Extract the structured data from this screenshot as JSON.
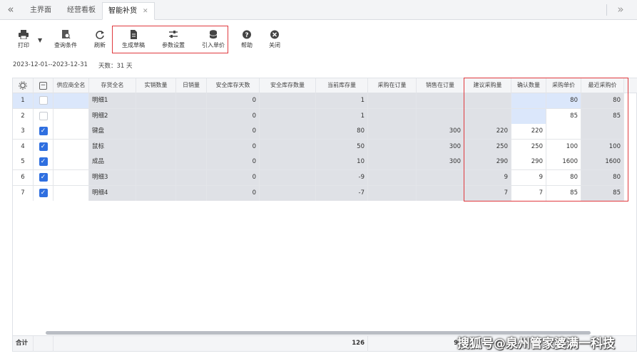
{
  "tabs": [
    {
      "label": "主界面"
    },
    {
      "label": "经营看板"
    },
    {
      "label": "智能补货",
      "closable": true
    }
  ],
  "tab_nav": {
    "left": "«",
    "right": "»"
  },
  "toolbar": {
    "print": "打印",
    "query": "查询条件",
    "refresh": "刷新",
    "generate_draft": "生成草稿",
    "params": "参数设置",
    "import_price": "引入单价",
    "help": "帮助",
    "close": "关闭"
  },
  "info": {
    "date_range": "2023-12-01--2023-12-31",
    "days": "天数：31 天"
  },
  "columns": [
    "供应商全名",
    "存货全名",
    "实销数量",
    "日销量",
    "安全库存天数",
    "安全库存数量",
    "当前库存量",
    "采购在订量",
    "销售在订量",
    "建议采购量",
    "确认数量",
    "采购单价",
    "最近采购价"
  ],
  "rows": [
    {
      "no": "1",
      "checked": false,
      "supplier": "",
      "item": "明细1",
      "sold": "",
      "daily": "",
      "safe_days": "0",
      "safe_qty": "",
      "stock": "1",
      "po": "",
      "so": "",
      "suggest": "",
      "confirm": "",
      "price": "80",
      "last_price": "80"
    },
    {
      "no": "2",
      "checked": false,
      "supplier": "",
      "item": "明细2",
      "sold": "",
      "daily": "",
      "safe_days": "0",
      "safe_qty": "",
      "stock": "1",
      "po": "",
      "so": "",
      "suggest": "",
      "confirm": "",
      "price": "85",
      "last_price": "85"
    },
    {
      "no": "3",
      "checked": true,
      "supplier": "",
      "item": "键盘",
      "sold": "",
      "daily": "",
      "safe_days": "0",
      "safe_qty": "",
      "stock": "80",
      "po": "",
      "so": "300",
      "suggest": "220",
      "confirm": "220",
      "price": "",
      "last_price": ""
    },
    {
      "no": "4",
      "checked": true,
      "supplier": "",
      "item": "鼠标",
      "sold": "",
      "daily": "",
      "safe_days": "0",
      "safe_qty": "",
      "stock": "50",
      "po": "",
      "so": "300",
      "suggest": "250",
      "confirm": "250",
      "price": "100",
      "last_price": "100"
    },
    {
      "no": "5",
      "checked": true,
      "supplier": "",
      "item": "成品",
      "sold": "",
      "daily": "",
      "safe_days": "0",
      "safe_qty": "",
      "stock": "10",
      "po": "",
      "so": "300",
      "suggest": "290",
      "confirm": "290",
      "price": "1600",
      "last_price": "1600"
    },
    {
      "no": "6",
      "checked": true,
      "supplier": "",
      "item": "明细3",
      "sold": "",
      "daily": "",
      "safe_days": "0",
      "safe_qty": "",
      "stock": "-9",
      "po": "",
      "so": "",
      "suggest": "9",
      "confirm": "9",
      "price": "80",
      "last_price": "80"
    },
    {
      "no": "7",
      "checked": true,
      "supplier": "",
      "item": "明细4",
      "sold": "",
      "daily": "",
      "safe_days": "0",
      "safe_qty": "",
      "stock": "-7",
      "po": "",
      "so": "",
      "suggest": "7",
      "confirm": "7",
      "price": "85",
      "last_price": "85"
    }
  ],
  "footer": {
    "label": "合计",
    "stock_total": "126",
    "so_total_partial": "9("
  },
  "watermark": "搜狐号@泉州管家婆满一科技",
  "colors": {
    "accent_blue": "#2f6fe0",
    "highlight_red": "#e0393e",
    "cell_shade": "#dfe1e6"
  }
}
